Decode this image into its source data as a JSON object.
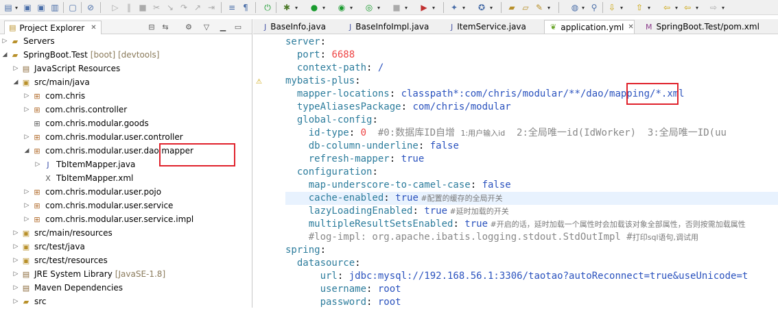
{
  "left_panel": {
    "tab_title": "Project Explorer",
    "tree": [
      {
        "label": "Servers",
        "deco": "",
        "depth": 1,
        "twisty": "▷",
        "icon": "folder"
      },
      {
        "label": "SpringBoot.Test",
        "deco": "[boot] [devtools]",
        "depth": 1,
        "twisty": "◢",
        "icon": "project"
      },
      {
        "label": "JavaScript Resources",
        "deco": "",
        "depth": 2,
        "twisty": "▷",
        "icon": "lib"
      },
      {
        "label": "src/main/java",
        "deco": "",
        "depth": 2,
        "twisty": "◢",
        "icon": "srcfolder"
      },
      {
        "label": "com.chris",
        "deco": "",
        "depth": 3,
        "twisty": "▷",
        "icon": "package"
      },
      {
        "label": "com.chris.controller",
        "deco": "",
        "depth": 3,
        "twisty": "▷",
        "icon": "package"
      },
      {
        "label": "com.chris.modular.goods",
        "deco": "",
        "depth": 3,
        "twisty": "",
        "icon": "emptypackage"
      },
      {
        "label": "com.chris.modular.user.controller",
        "deco": "",
        "depth": 3,
        "twisty": "▷",
        "icon": "package"
      },
      {
        "label": "com.chris.modular.user.dao.mapper",
        "deco": "",
        "depth": 3,
        "twisty": "◢",
        "icon": "package"
      },
      {
        "label": "TbItemMapper.java",
        "deco": "",
        "depth": 4,
        "twisty": "▷",
        "icon": "javafile"
      },
      {
        "label": "TbItemMapper.xml",
        "deco": "",
        "depth": 4,
        "twisty": "",
        "icon": "xmlfile"
      },
      {
        "label": "com.chris.modular.user.pojo",
        "deco": "",
        "depth": 3,
        "twisty": "▷",
        "icon": "package"
      },
      {
        "label": "com.chris.modular.user.service",
        "deco": "",
        "depth": 3,
        "twisty": "▷",
        "icon": "package"
      },
      {
        "label": "com.chris.modular.user.service.impl",
        "deco": "",
        "depth": 3,
        "twisty": "▷",
        "icon": "package"
      },
      {
        "label": "src/main/resources",
        "deco": "",
        "depth": 2,
        "twisty": "▷",
        "icon": "srcfolder"
      },
      {
        "label": "src/test/java",
        "deco": "",
        "depth": 2,
        "twisty": "▷",
        "icon": "srcfolder"
      },
      {
        "label": "src/test/resources",
        "deco": "",
        "depth": 2,
        "twisty": "▷",
        "icon": "srcfolder"
      },
      {
        "label": "JRE System Library",
        "deco": "[JavaSE-1.8]",
        "depth": 2,
        "twisty": "▷",
        "icon": "lib"
      },
      {
        "label": "Maven Dependencies",
        "deco": "",
        "depth": 2,
        "twisty": "▷",
        "icon": "lib"
      },
      {
        "label": "src",
        "deco": "",
        "depth": 2,
        "twisty": "▷",
        "icon": "folder"
      }
    ]
  },
  "editor": {
    "tabs": [
      {
        "label": "BaseInfo.java",
        "icon": "java-file-icon",
        "active": false
      },
      {
        "label": "BaseInfoImpl.java",
        "icon": "java-file-icon",
        "active": false
      },
      {
        "label": "ItemService.java",
        "icon": "java-file-icon",
        "active": false
      },
      {
        "label": "application.yml",
        "icon": "yaml-leaf-icon",
        "active": true
      },
      {
        "label": "SpringBoot.Test/pom.xml",
        "icon": "maven-m-icon",
        "active": false
      }
    ],
    "close_glyph": "✕",
    "lines": [
      [
        {
          "t": "server",
          "c": "k"
        },
        {
          "t": ":",
          "c": ""
        }
      ],
      [
        {
          "t": "  port",
          "c": "k"
        },
        {
          "t": ": ",
          "c": ""
        },
        {
          "t": "6688",
          "c": "n"
        }
      ],
      [
        {
          "t": "  context-path",
          "c": "k"
        },
        {
          "t": ": ",
          "c": ""
        },
        {
          "t": "/",
          "c": "v"
        }
      ],
      [
        {
          "t": "mybatis-plus",
          "c": "k"
        },
        {
          "t": ":",
          "c": ""
        }
      ],
      [
        {
          "t": "  mapper-locations",
          "c": "k"
        },
        {
          "t": ": ",
          "c": ""
        },
        {
          "t": "classpath*:com/chris/modular/**/dao/",
          "c": "v"
        },
        {
          "t": "mapping",
          "c": "v"
        },
        {
          "t": "/*.xml",
          "c": "v"
        }
      ],
      [
        {
          "t": "  typeAliasesPackage",
          "c": "k"
        },
        {
          "t": ": ",
          "c": ""
        },
        {
          "t": "com/chris/modular",
          "c": "v"
        }
      ],
      [
        {
          "t": "  global-config",
          "c": "k"
        },
        {
          "t": ":",
          "c": ""
        }
      ],
      [
        {
          "t": "    id-type",
          "c": "k"
        },
        {
          "t": ": ",
          "c": ""
        },
        {
          "t": "0",
          "c": "n"
        },
        {
          "t": "  #0:数据库ID自增 ",
          "c": "c2"
        },
        {
          "t": "1:用户输入id",
          "c": "c"
        },
        {
          "t": "  2:全局唯一id(IdWorker)  3:全局唯一ID(uu",
          "c": "c2"
        }
      ],
      [
        {
          "t": "    db-column-underline",
          "c": "k"
        },
        {
          "t": ": ",
          "c": ""
        },
        {
          "t": "false",
          "c": "v"
        }
      ],
      [
        {
          "t": "    refresh-mapper",
          "c": "k"
        },
        {
          "t": ": ",
          "c": ""
        },
        {
          "t": "true",
          "c": "v"
        }
      ],
      [
        {
          "t": "  configuration",
          "c": "k"
        },
        {
          "t": ":",
          "c": ""
        }
      ],
      [
        {
          "t": "    map-underscore-to-camel-case",
          "c": "k"
        },
        {
          "t": ": ",
          "c": ""
        },
        {
          "t": "false",
          "c": "v"
        }
      ],
      [
        {
          "t": "    cache-enabled",
          "c": "k"
        },
        {
          "t": ": ",
          "c": ""
        },
        {
          "t": "true",
          "c": "v"
        },
        {
          "t": " #配置的缓存的全局开关",
          "c": "c"
        }
      ],
      [
        {
          "t": "    lazyLoadingEnabled",
          "c": "k"
        },
        {
          "t": ": ",
          "c": ""
        },
        {
          "t": "true",
          "c": "v"
        },
        {
          "t": " #延时加载的开关",
          "c": "c"
        }
      ],
      [
        {
          "t": "    multipleResultSetsEnabled",
          "c": "k"
        },
        {
          "t": ": ",
          "c": ""
        },
        {
          "t": "true",
          "c": "v"
        },
        {
          "t": " #开启的话，延时加载一个属性时会加载该对象全部属性，否则按需加载属性",
          "c": "c"
        }
      ],
      [
        {
          "t": "    #log-impl: org.apache.ibatis.logging.stdout.StdOutImpl #",
          "c": "c2"
        },
        {
          "t": "打印sql语句,调试用",
          "c": "c"
        }
      ],
      [
        {
          "t": "spring",
          "c": "k"
        },
        {
          "t": ":",
          "c": ""
        }
      ],
      [
        {
          "t": "  datasource",
          "c": "k"
        },
        {
          "t": ":",
          "c": ""
        }
      ],
      [
        {
          "t": "      url",
          "c": "k"
        },
        {
          "t": ": ",
          "c": ""
        },
        {
          "t": "jdbc:mysql://192.168.56.1:3306/taotao?autoReconnect=true&useUnicode=t",
          "c": "v"
        }
      ],
      [
        {
          "t": "      username",
          "c": "k"
        },
        {
          "t": ": ",
          "c": ""
        },
        {
          "t": "root",
          "c": "v"
        }
      ],
      [
        {
          "t": "      password",
          "c": "k"
        },
        {
          "t": ": ",
          "c": ""
        },
        {
          "t": "root",
          "c": "v"
        }
      ]
    ],
    "current_line": 12
  }
}
